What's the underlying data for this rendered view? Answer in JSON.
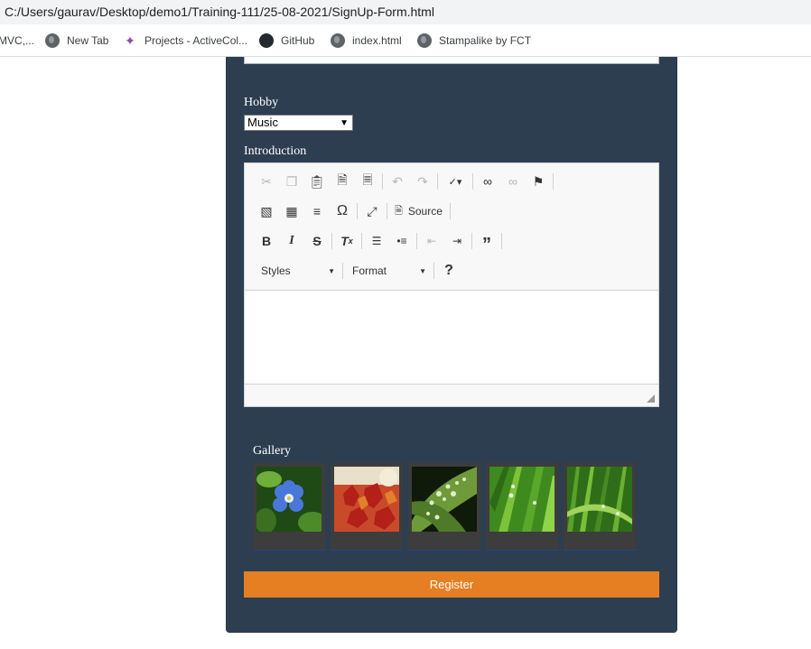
{
  "browser": {
    "url": "C:/Users/gaurav/Desktop/demo1/Training-111/25-08-2021/SignUp-Form.html",
    "bookmarks": [
      {
        "label": "MVC,...",
        "icon": "globe-icon"
      },
      {
        "label": "New Tab",
        "icon": "globe-icon"
      },
      {
        "label": "Projects - ActiveCol...",
        "icon": "activecollab-icon"
      },
      {
        "label": "GitHub",
        "icon": "github-icon"
      },
      {
        "label": "index.html",
        "icon": "globe-icon"
      },
      {
        "label": "Stampalike by FCT",
        "icon": "globe-icon"
      }
    ]
  },
  "form": {
    "hobby_label": "Hobby",
    "hobby_value": "Music",
    "intro_label": "Introduction",
    "editor": {
      "source_label": "Source",
      "styles_label": "Styles",
      "format_label": "Format",
      "content": ""
    },
    "gallery_label": "Gallery",
    "gallery_images": [
      "blue-flower-image",
      "red-maple-leaves-image",
      "dewy-leaf-image",
      "green-grass-drops-image",
      "grass-blades-image"
    ],
    "register_label": "Register"
  },
  "colors": {
    "panel_bg": "#2c3e50",
    "register_bg": "#e67e22",
    "gallery_frame": "#3d3d3d"
  }
}
